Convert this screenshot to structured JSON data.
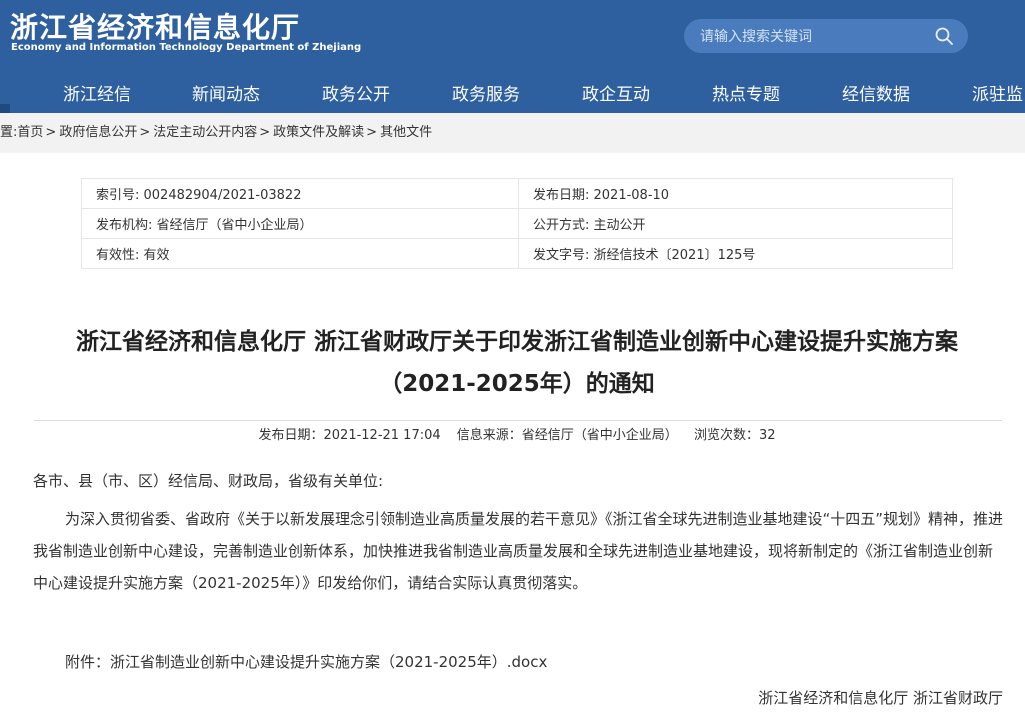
{
  "header": {
    "logo_cn": "浙江省经济和信息化厅",
    "logo_en": "Economy and Information Technology Department of Zhejiang",
    "search_placeholder": "请输入搜索关键词"
  },
  "nav": {
    "items": [
      "浙江经信",
      "新闻动态",
      "政务公开",
      "政务服务",
      "政企互动",
      "热点专题",
      "经信数据",
      "派驻监"
    ]
  },
  "breadcrumb": {
    "prefix": "置:",
    "items": [
      "首页",
      "政府信息公开",
      "法定主动公开内容",
      "政策文件及解读",
      "其他文件"
    ],
    "separator": ">"
  },
  "meta": {
    "index_no": "索引号: 002482904/2021-03822",
    "publish_date": "发布日期: 2021-08-10",
    "publisher": "发布机构: 省经信厅（省中小企业局）",
    "open_mode": "公开方式: 主动公开",
    "validity": "有效性: 有效",
    "doc_no": "发文字号: 浙经信技术〔2021〕125号"
  },
  "article": {
    "title": "浙江省经济和信息化厅 浙江省财政厅关于印发浙江省制造业创新中心建设提升实施方案（2021-2025年）的通知",
    "publish_time": "发布日期：2021-12-21 17:04",
    "source": "信息来源：省经信厅（省中小企业局）",
    "views": "浏览次数：32",
    "salutation": "各市、县（市、区）经信局、财政局，省级有关单位:",
    "paragraph": "为深入贯彻省委、省政府《关于以新发展理念引领制造业高质量发展的若干意见》《浙江省全球先进制造业基地建设“十四五”规划》精神，推进我省制造业创新中心建设，完善制造业创新体系，加快推进我省制造业高质量发展和全球先进制造业基地建设，现将新制定的《浙江省制造业创新中心建设提升实施方案（2021-2025年）》印发给你们，请结合实际认真贯彻落实。",
    "attachment": "附件：浙江省制造业创新中心建设提升实施方案（2021-2025年）.docx",
    "signature": "浙江省经济和信息化厅  浙江省财政厅"
  },
  "colors": {
    "header_bg": "#2e5f9e",
    "search_bg": "#4a7cbd",
    "breadcrumb_bg": "#f2f2f2"
  }
}
